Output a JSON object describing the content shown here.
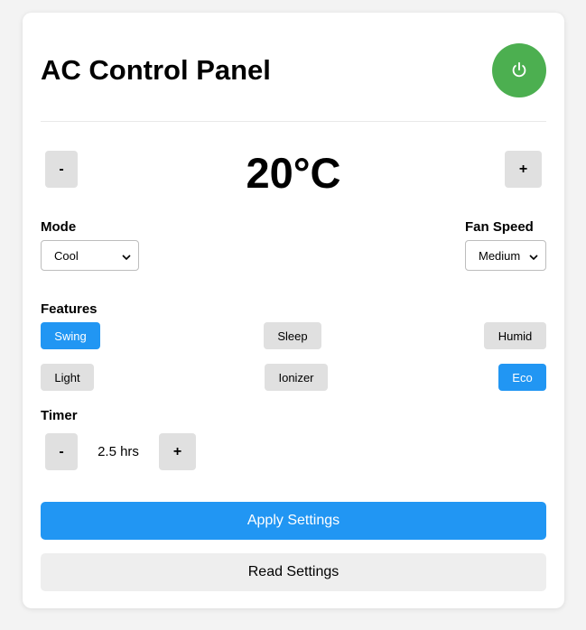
{
  "header": {
    "title": "AC Control Panel"
  },
  "power": {
    "icon": "power-icon",
    "color": "#4caf50",
    "on": true
  },
  "temperature": {
    "decrease_label": "-",
    "value": "20°C",
    "increase_label": "+"
  },
  "mode": {
    "label": "Mode",
    "selected": "Cool"
  },
  "fan_speed": {
    "label": "Fan Speed",
    "selected": "Medium"
  },
  "features": {
    "label": "Features",
    "items": [
      {
        "label": "Swing",
        "active": true
      },
      {
        "label": "Sleep",
        "active": false
      },
      {
        "label": "Humid",
        "active": false
      },
      {
        "label": "Light",
        "active": false
      },
      {
        "label": "Ionizer",
        "active": false
      },
      {
        "label": "Eco",
        "active": true
      }
    ]
  },
  "timer": {
    "label": "Timer",
    "decrease_label": "-",
    "value": "2.5 hrs",
    "increase_label": "+"
  },
  "actions": {
    "apply_label": "Apply Settings",
    "read_label": "Read Settings"
  },
  "colors": {
    "accent": "#2196f3",
    "inactive": "#e0e0e0"
  }
}
